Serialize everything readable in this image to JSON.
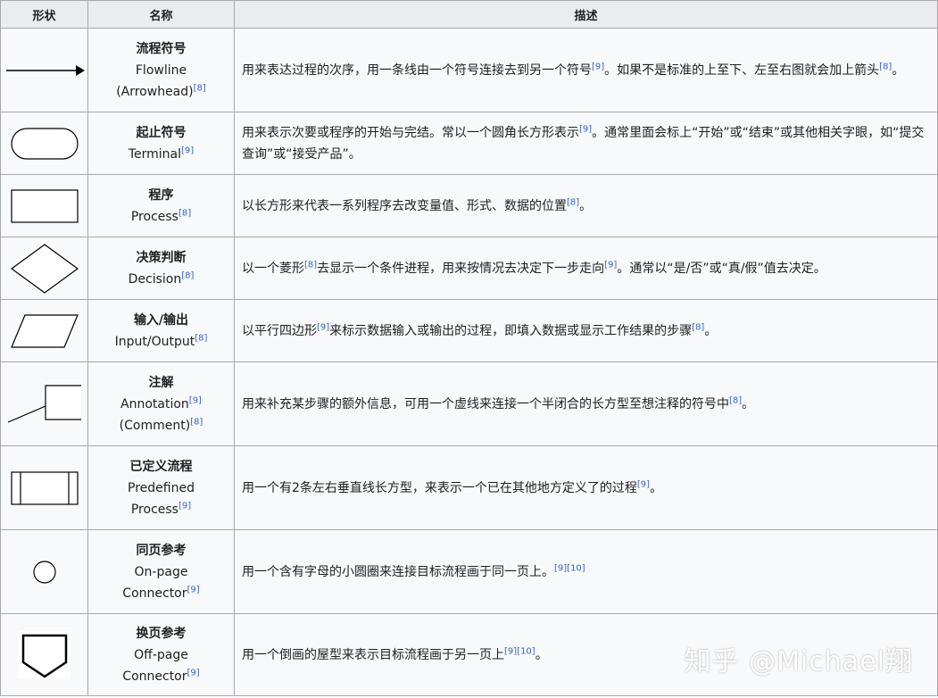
{
  "headers": {
    "shape": "形状",
    "name": "名称",
    "description": "描述"
  },
  "rows": [
    {
      "icon": "flowline-arrow-icon",
      "zh": "流程符号",
      "en": "Flowline",
      "en2": "(Arrowhead)",
      "en2_ref": "[8]",
      "desc": [
        {
          "t": "用来表达过程的次序，用一条线由一个符号连接去到另一个符号"
        },
        {
          "r": "[9]"
        },
        {
          "t": "。如果不是标准的上至下、左至右图就会加上箭头"
        },
        {
          "r": "[8]"
        },
        {
          "t": "。"
        }
      ]
    },
    {
      "icon": "terminal-rounded-rect-icon",
      "zh": "起止符号",
      "en": "Terminal",
      "en_ref": "[9]",
      "desc": [
        {
          "t": "用来表示次要或程序的开始与完结。常以一个圆角长方形表示"
        },
        {
          "r": "[9]"
        },
        {
          "t": "。通常里面会标上“开始”或“结束”或其他相关字眼，如“提交查询”或“接受产品”。"
        }
      ]
    },
    {
      "icon": "process-rect-icon",
      "zh": "程序",
      "en": "Process",
      "en_ref": "[8]",
      "desc": [
        {
          "t": "以长方形来代表一系列程序去改变量值、形式、数据的位置"
        },
        {
          "r": "[8]"
        },
        {
          "t": "。"
        }
      ]
    },
    {
      "icon": "decision-diamond-icon",
      "zh": "决策判断",
      "en": "Decision",
      "en_ref": "[8]",
      "desc": [
        {
          "t": "以一个菱形"
        },
        {
          "r": "[8]"
        },
        {
          "t": "去显示一个条件进程，用来按情况去决定下一步走向"
        },
        {
          "r": "[9]"
        },
        {
          "t": "。通常以“是/否”或“真/假”值去决定。"
        }
      ]
    },
    {
      "icon": "input-output-parallelogram-icon",
      "zh": "输入/输出",
      "en": "Input/Output",
      "en_ref": "[8]",
      "desc": [
        {
          "t": "以平行四边形"
        },
        {
          "r": "[9]"
        },
        {
          "t": "来标示数据输入或输出的过程，即填入数据或显示工作结果的步骤"
        },
        {
          "r": "[8]"
        },
        {
          "t": "。"
        }
      ]
    },
    {
      "icon": "annotation-bracket-icon",
      "zh": "注解",
      "en": "Annotation",
      "en_ref": "[9]",
      "en2": "(Comment)",
      "en2_ref": "[8]",
      "desc": [
        {
          "t": "用来补充某步骤的额外信息，可用一个虚线来连接一个半闭合的长方型至想注释的符号中"
        },
        {
          "r": "[8]"
        },
        {
          "t": "。"
        }
      ]
    },
    {
      "icon": "predefined-process-icon",
      "zh": "已定义流程",
      "en": "Predefined",
      "en2": "Process",
      "en2_ref": "[9]",
      "desc": [
        {
          "t": "用一个有2条左右垂直线长方型，来表示一个已在其他地方定义了的过程"
        },
        {
          "r": "[9]"
        },
        {
          "t": "。"
        }
      ]
    },
    {
      "icon": "on-page-connector-circle-icon",
      "zh": "同页参考",
      "en": "On-page",
      "en2": "Connector",
      "en2_ref": "[9]",
      "desc": [
        {
          "t": "用一个含有字母的小圆圈来连接目标流程画于同一页上。"
        },
        {
          "r": "[9][10]"
        }
      ]
    },
    {
      "icon": "off-page-connector-pentagon-icon",
      "zh": "换页参考",
      "en": "Off-page",
      "en2": "Connector",
      "en2_ref": "[9]",
      "desc": [
        {
          "t": "用一个倒画的屋型来表示目标流程画于另一页上"
        },
        {
          "r": "[9][10]"
        },
        {
          "t": "。"
        }
      ]
    }
  ],
  "watermark": "知乎 @Michael翔"
}
